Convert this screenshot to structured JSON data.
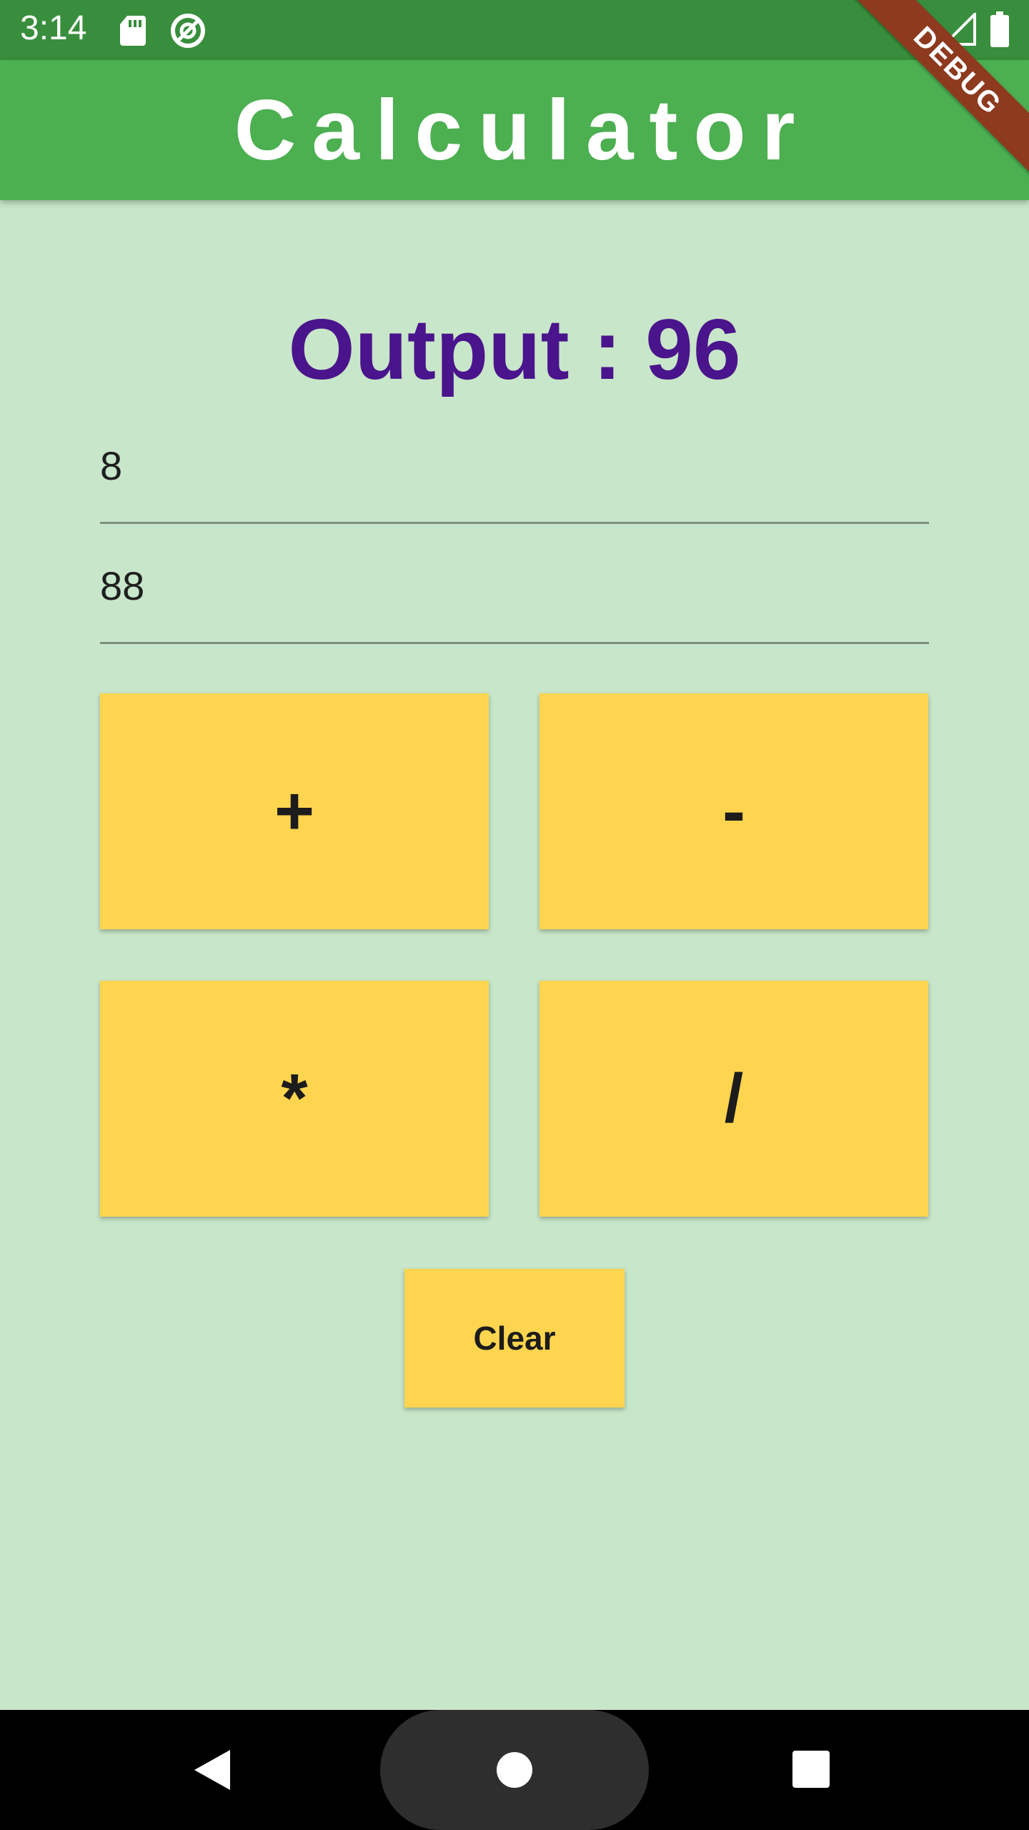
{
  "status_bar": {
    "time": "3:14",
    "icons": [
      "sd-card-icon",
      "data-saver-icon",
      "wifi-icon",
      "signal-icon",
      "battery-icon"
    ]
  },
  "app_bar": {
    "title": "Calculator"
  },
  "debug_banner": {
    "label": "DEBUG"
  },
  "output": {
    "text": "Output : 96"
  },
  "inputs": {
    "first_value": "8",
    "second_value": "88"
  },
  "operators": {
    "add": "+",
    "subtract": "-",
    "multiply": "*",
    "divide": "/"
  },
  "clear_label": "Clear",
  "nav_bar": {
    "icons": [
      "back-icon",
      "home-icon",
      "recents-icon"
    ]
  },
  "colors": {
    "status_bar": "#388e3c",
    "app_bar": "#4caf50",
    "background": "#c8e6c9",
    "output_text": "#4a148c",
    "button": "#ffd54f"
  }
}
